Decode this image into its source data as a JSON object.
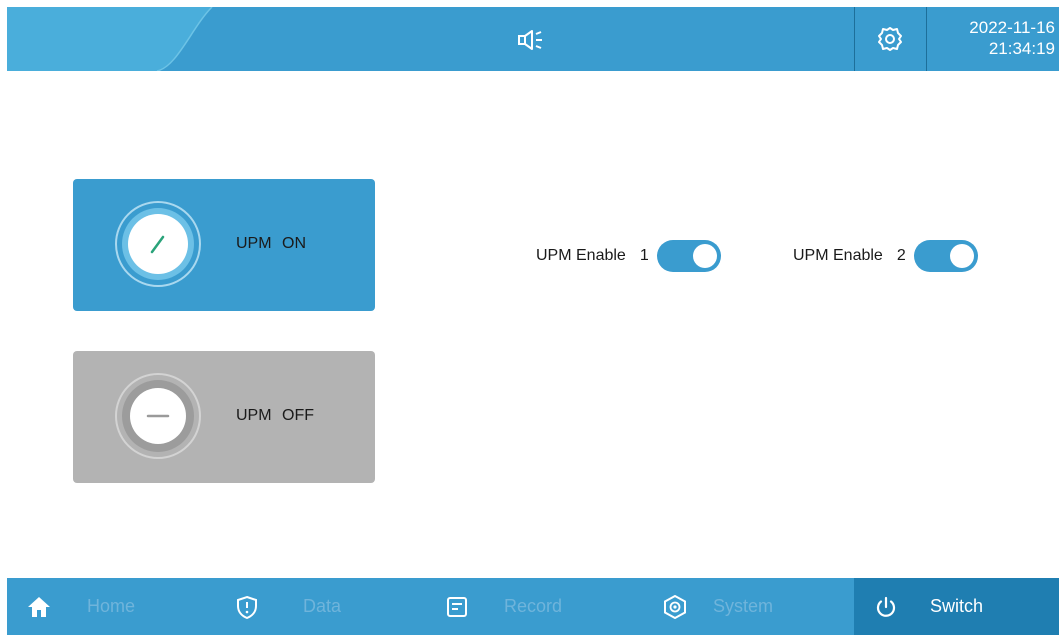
{
  "header": {
    "speaker_icon": "speaker-icon",
    "settings_icon": "gear-icon",
    "date": "2022-11-16",
    "time": "21:34:19"
  },
  "controls": {
    "upm_on_label": "UPM  ON",
    "upm_off_label": "UPM  OFF",
    "enable1_label": "UPM Enable",
    "enable1_num": "1",
    "enable2_label": "UPM Enable",
    "enable2_num": "2",
    "enable1_on": true,
    "enable2_on": true
  },
  "nav": {
    "items": [
      {
        "label": "Home",
        "icon": "home-icon"
      },
      {
        "label": "Data",
        "icon": "shield-alert-icon"
      },
      {
        "label": "Record",
        "icon": "document-icon"
      },
      {
        "label": "System",
        "icon": "system-shield-icon"
      },
      {
        "label": "Switch",
        "icon": "power-icon"
      }
    ],
    "active": "Switch"
  },
  "colors": {
    "primary": "#3a9ccf",
    "active_nav": "#1f7eb1",
    "inactive_text": "#6fb4db",
    "off_button": "#b3b3b3"
  }
}
